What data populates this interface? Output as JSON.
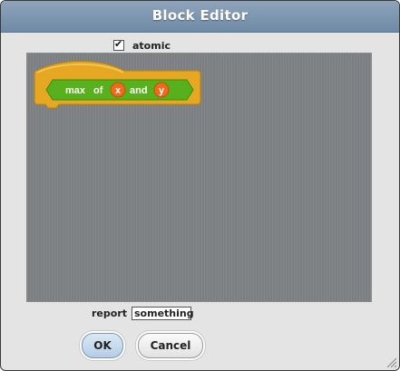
{
  "window": {
    "title": "Block Editor"
  },
  "options": {
    "atomic_label": "atomic",
    "atomic_checked": true
  },
  "block": {
    "color": "#e6a822",
    "reporter_color": "#56b11c",
    "var_color": "#f06a1d",
    "words": [
      "max",
      "of",
      "and"
    ],
    "params": [
      "x",
      "y"
    ]
  },
  "report": {
    "label": "report",
    "value": "something"
  },
  "buttons": {
    "ok_label": "OK",
    "cancel_label": "Cancel"
  }
}
